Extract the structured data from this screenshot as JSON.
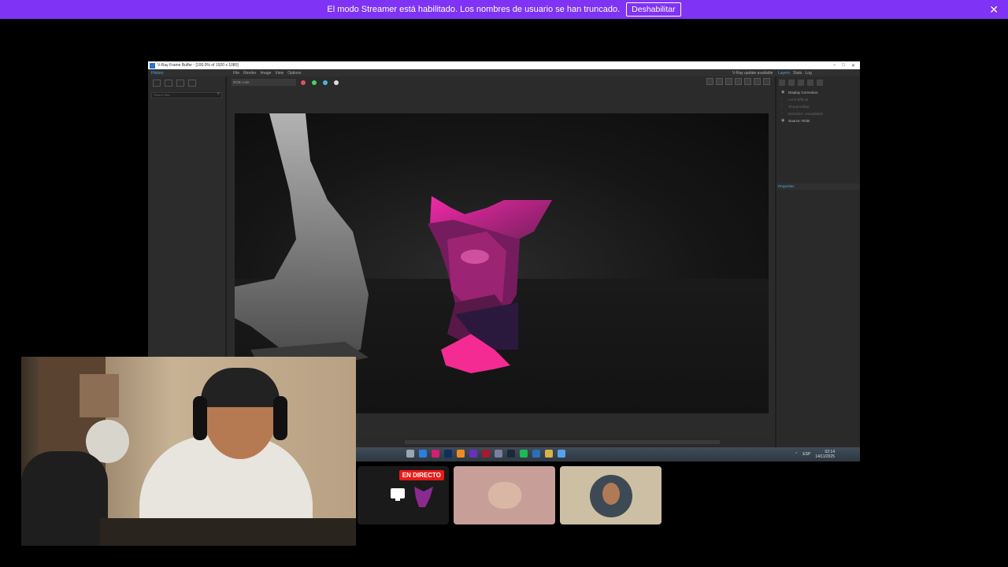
{
  "banner": {
    "message": "El modo Streamer está habilitado. Los nombres de usuario se han truncado.",
    "button_label": "Deshabilitar",
    "close_glyph": "✕",
    "background": "#7f33f5"
  },
  "vfb": {
    "title": "V-Ray Frame Buffer - [100.0% of 1920 x 1080]",
    "history_tab": "History",
    "menus": [
      "File",
      "Render",
      "Image",
      "View",
      "Options"
    ],
    "update_notice": "V-Ray update available",
    "right_tabs": [
      "Layers",
      "Stats",
      "Log"
    ],
    "search_placeholder": "Search files",
    "channel": "RGB color",
    "layers": [
      {
        "label": "Display Correction",
        "dim": false
      },
      {
        "label": "Lens Effects",
        "dim": true
      },
      {
        "label": "Sharpen/Blur",
        "dim": true
      },
      {
        "label": "Denoiser: unavailable",
        "dim": true
      },
      {
        "label": "Source: RGB",
        "dim": false
      }
    ],
    "properties_label": "Properties"
  },
  "taskbar": {
    "lang": "ESP",
    "time": "02:14",
    "date": "14/11/2025"
  },
  "tiles": {
    "live_label": "EN DIRECTO"
  }
}
